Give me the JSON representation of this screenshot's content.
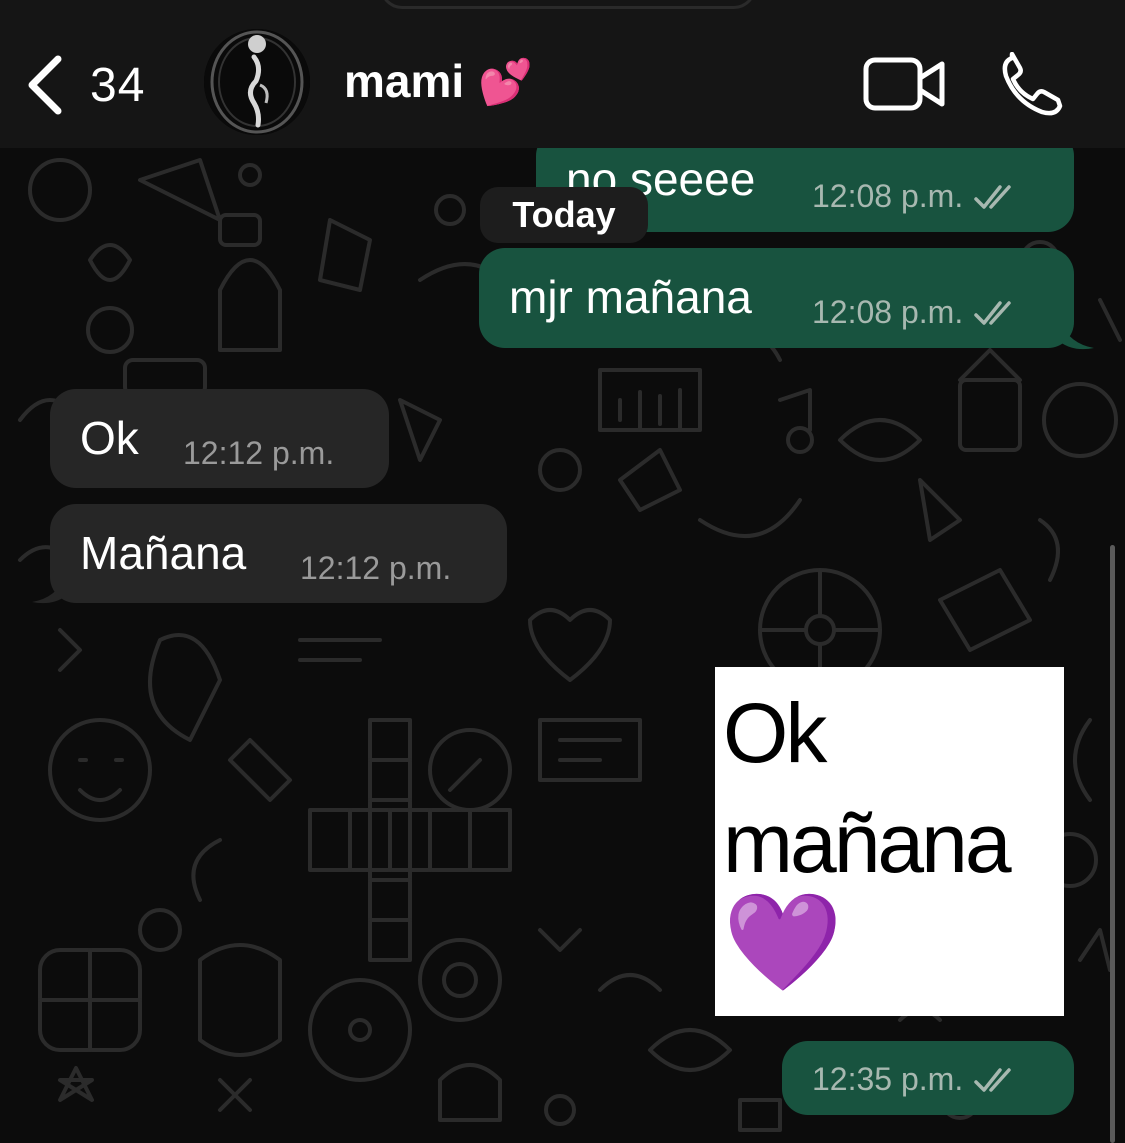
{
  "header": {
    "back_count": "34",
    "contact_name": "mami",
    "contact_emoji": "💕",
    "icons": [
      "back-chevron-icon",
      "video-call-icon",
      "phone-call-icon"
    ]
  },
  "date_separator": "Today",
  "messages": [
    {
      "direction": "outgoing",
      "text": "no seeee",
      "time": "12:08 p.m.",
      "status": "read"
    },
    {
      "direction": "outgoing",
      "text": "mjr mañana",
      "time": "12:08 p.m.",
      "status": "read"
    },
    {
      "direction": "incoming",
      "text": "Ok",
      "time": "12:12 p.m."
    },
    {
      "direction": "incoming",
      "text": "Mañana",
      "time": "12:12 p.m."
    },
    {
      "direction": "outgoing",
      "type": "sticker",
      "sticker_lines": [
        "Ok",
        "mañana"
      ],
      "sticker_emoji": "💜",
      "time": "12:35 p.m.",
      "status": "read"
    }
  ],
  "colors": {
    "outgoing_bubble": "#18533f",
    "incoming_bubble": "#262626",
    "header_bg": "#151515",
    "chat_bg": "#0c0c0c"
  }
}
